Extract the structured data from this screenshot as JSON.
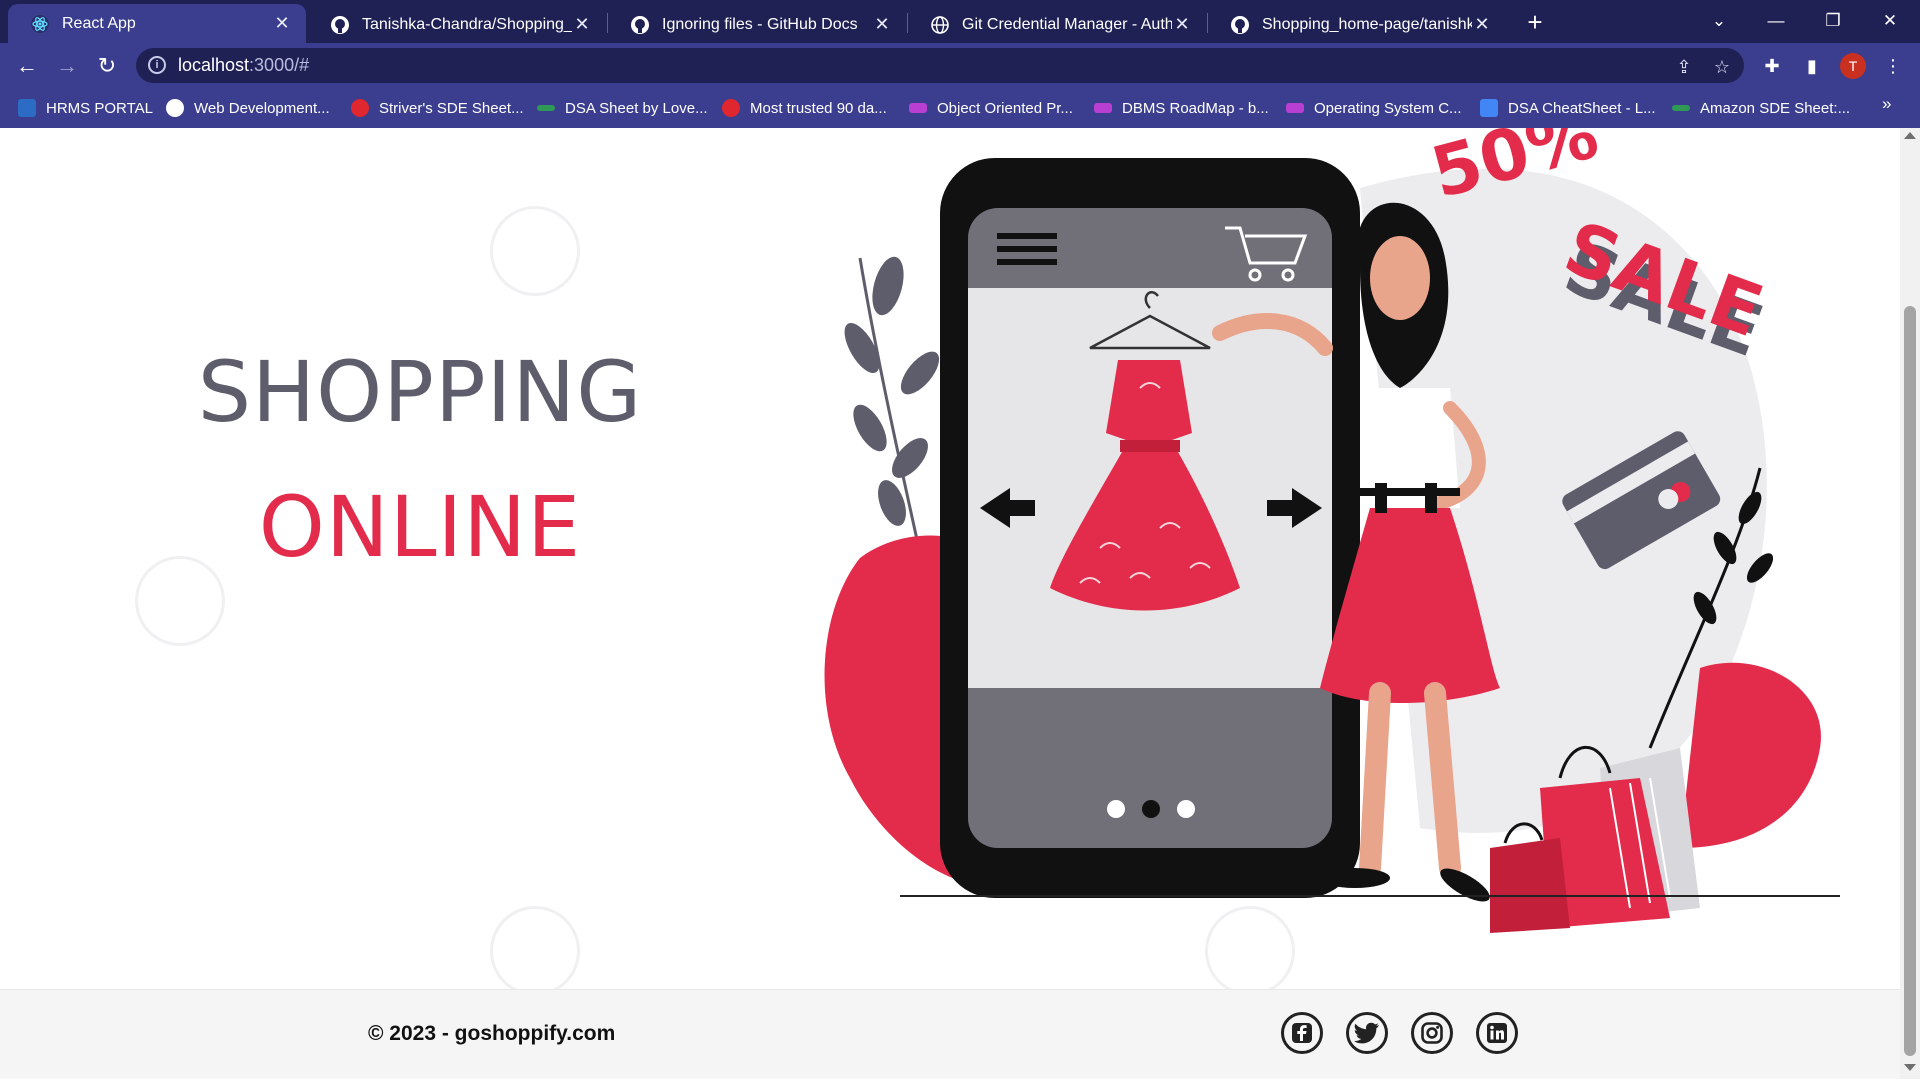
{
  "browser": {
    "tabs": [
      {
        "title": "React App",
        "active": true,
        "icon": "react-icon"
      },
      {
        "title": "Tanishka-Chandra/Shopping_home",
        "active": false,
        "icon": "github-icon"
      },
      {
        "title": "Ignoring files - GitHub Docs",
        "active": false,
        "icon": "github-icon"
      },
      {
        "title": "Git Credential Manager - Authen",
        "active": false,
        "icon": "globe-icon"
      },
      {
        "title": "Shopping_home-page/tanishka-c",
        "active": false,
        "icon": "github-icon"
      }
    ],
    "url_host": "localhost",
    "url_path": ":3000/#",
    "profile_initial": "T",
    "bookmarks": [
      {
        "label": "HRMS PORTAL",
        "icon": "hrms-icon"
      },
      {
        "label": "Web Development...",
        "icon": "web-dev-icon"
      },
      {
        "label": "Striver's SDE Sheet...",
        "icon": "tuf-icon"
      },
      {
        "label": "DSA Sheet by Love...",
        "icon": "code-icon"
      },
      {
        "label": "Most trusted 90 da...",
        "icon": "tuf-icon"
      },
      {
        "label": "Object Oriented Pr...",
        "icon": "ds-icon"
      },
      {
        "label": "DBMS RoadMap - b...",
        "icon": "ds-icon"
      },
      {
        "label": "Operating System C...",
        "icon": "ds-icon"
      },
      {
        "label": "DSA CheatSheet - L...",
        "icon": "doc-icon"
      },
      {
        "label": "Amazon SDE Sheet:...",
        "icon": "code-icon"
      }
    ],
    "more_bookmarks": "»"
  },
  "hero": {
    "line1": "SHOPPING",
    "line2": "ONLINE",
    "illustration": {
      "badge_percent": "50%",
      "sale_text": "SALE",
      "phone_page_dots": 3,
      "active_dot": 2
    }
  },
  "footer": {
    "copyright": "© 2023 - goshoppify.com",
    "social": [
      "facebook-icon",
      "twitter-icon",
      "instagram-icon",
      "linkedin-icon"
    ]
  },
  "colors": {
    "tabbar": "#1f2155",
    "toolbar": "#3b3e8f",
    "accent_red": "#e32b4b",
    "title_gray": "#5e5d6c",
    "footer_bg": "#f5f5f5"
  }
}
